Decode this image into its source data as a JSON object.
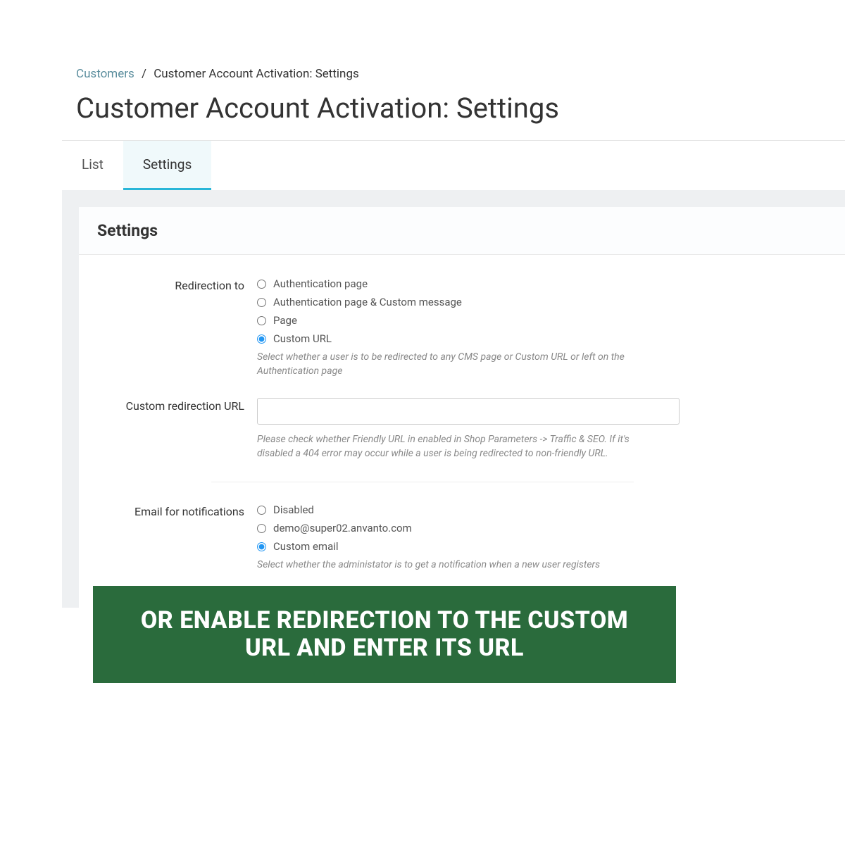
{
  "breadcrumb": {
    "parent": "Customers",
    "separator": "/",
    "current": "Customer Account Activation: Settings"
  },
  "page_title": "Customer Account Activation: Settings",
  "tabs": {
    "list": "List",
    "settings": "Settings"
  },
  "panel": {
    "heading": "Settings"
  },
  "form": {
    "redirection": {
      "label": "Redirection to",
      "options": {
        "auth": "Authentication page",
        "auth_msg": "Authentication page & Custom message",
        "page": "Page",
        "custom_url": "Custom URL"
      },
      "help": "Select whether a user is to be redirected to any CMS page or Custom URL or left on the Authentication page"
    },
    "custom_url": {
      "label": "Custom redirection URL",
      "value": "",
      "help": "Please check whether Friendly URL in enabled in Shop Parameters -> Traffic & SEO. If it's disabled a 404 error may occur while a user is being redirected to non-friendly URL."
    },
    "email": {
      "label": "Email for notifications",
      "options": {
        "disabled": "Disabled",
        "demo": "demo@super02.anvanto.com",
        "custom": "Custom email"
      },
      "help": "Select whether the administator is to get a notification when a new user registers"
    }
  },
  "banner": {
    "text": "OR ENABLE REDIRECTION TO THE CUSTOM URL AND ENTER ITS URL"
  }
}
